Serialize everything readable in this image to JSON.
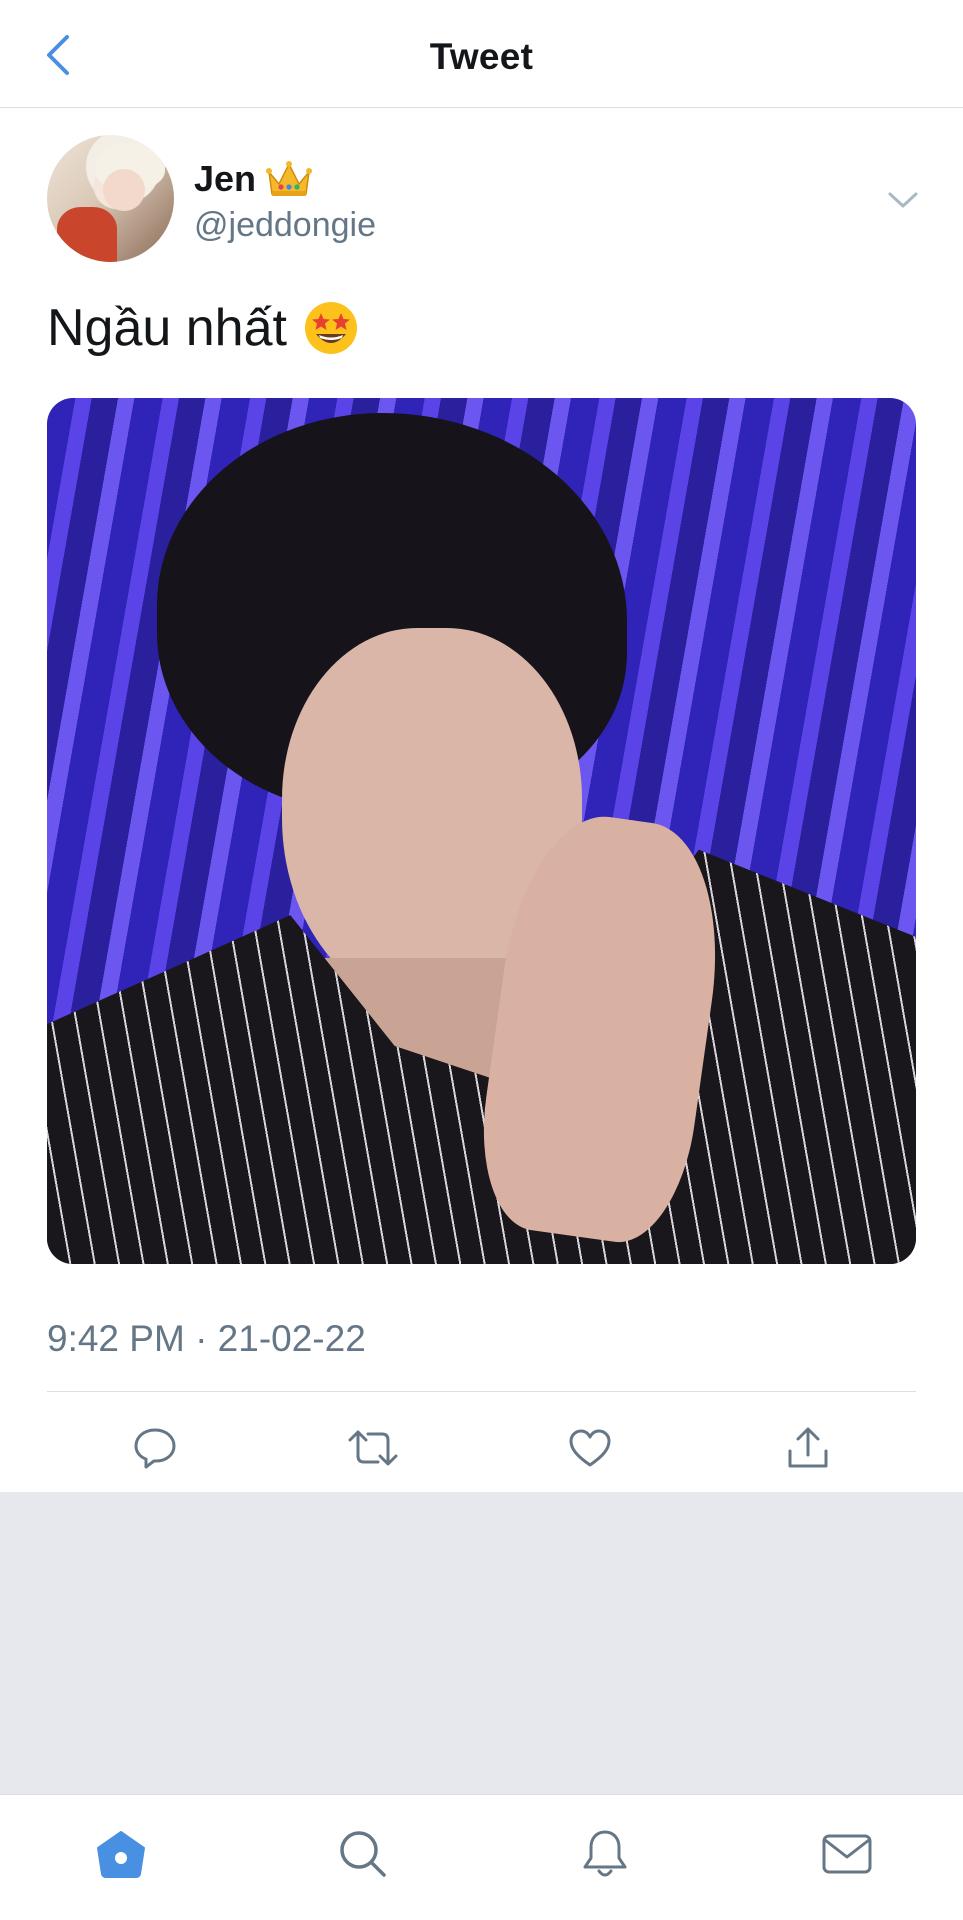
{
  "header": {
    "title": "Tweet",
    "back_icon": "chevron-left-icon"
  },
  "author": {
    "display_name": "Jen",
    "badge_emoji": "crown",
    "handle": "@jeddongie"
  },
  "tweet": {
    "text": "Ngầu nhất",
    "emoji": "star-struck-face",
    "timestamp": "9:42 PM · 21-02-22"
  },
  "actions": [
    {
      "name": "reply",
      "icon": "speech-bubble-icon"
    },
    {
      "name": "retweet",
      "icon": "retweet-icon"
    },
    {
      "name": "like",
      "icon": "heart-icon"
    },
    {
      "name": "share",
      "icon": "share-icon"
    }
  ],
  "tabbar": [
    {
      "name": "home",
      "icon": "home-icon",
      "active": true
    },
    {
      "name": "search",
      "icon": "search-icon",
      "active": false
    },
    {
      "name": "notifications",
      "icon": "bell-icon",
      "active": false
    },
    {
      "name": "messages",
      "icon": "mail-icon",
      "active": false
    }
  ],
  "colors": {
    "accent": "#4a90e2",
    "text_primary": "#14171a",
    "text_secondary": "#657786",
    "divider": "#dcdfe3",
    "background_gray": "#e6e8ed"
  }
}
